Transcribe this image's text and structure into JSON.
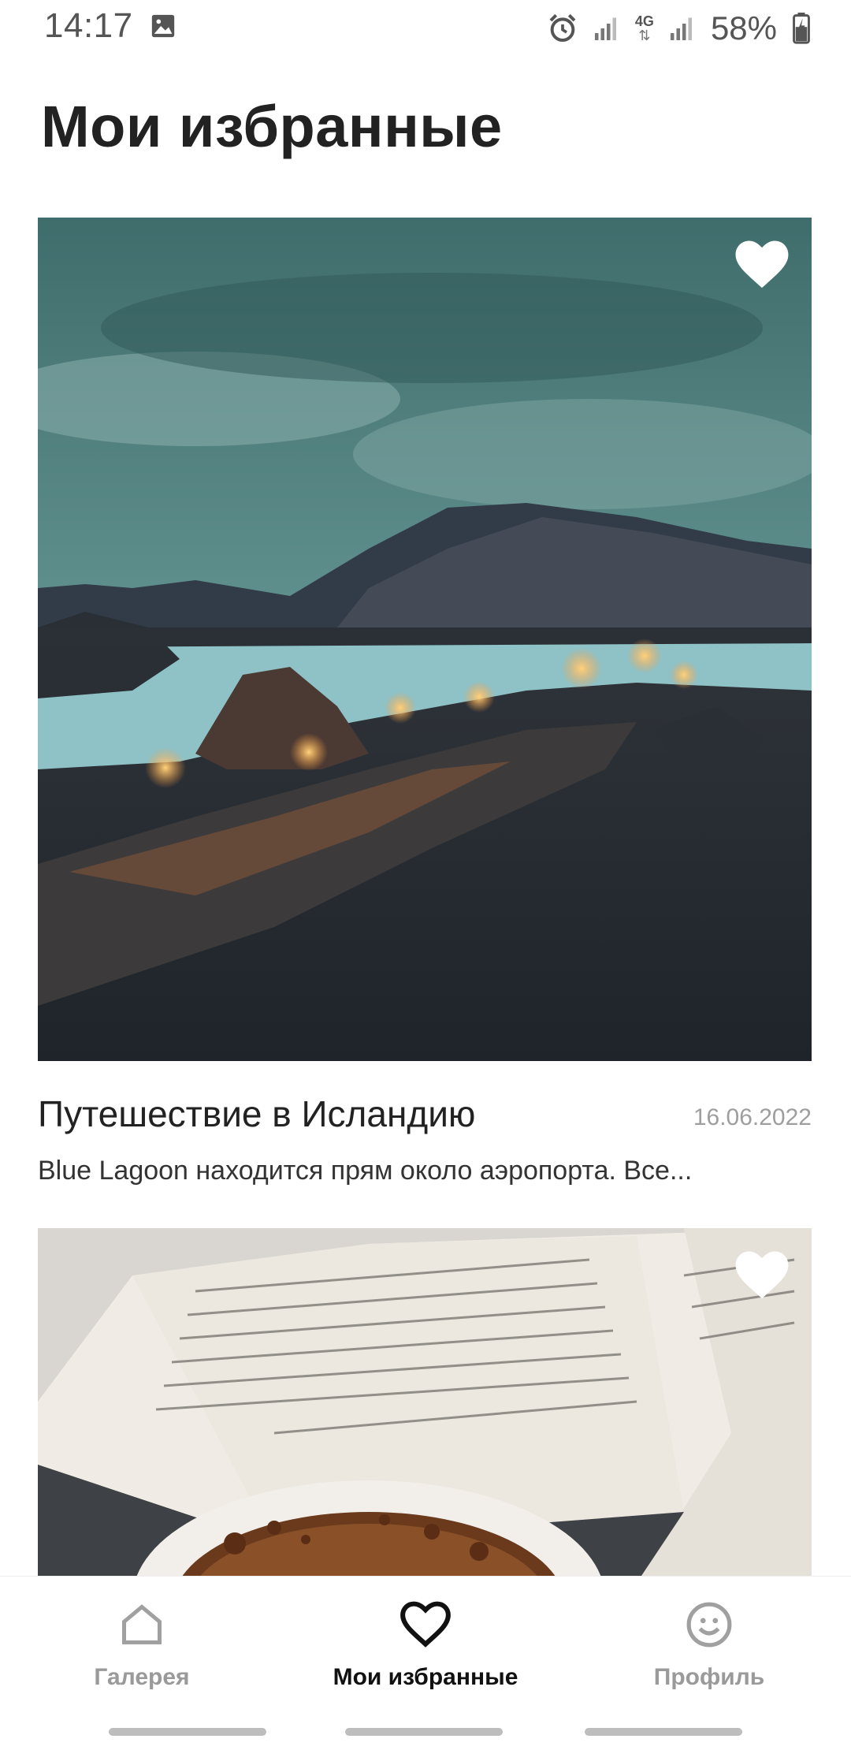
{
  "status_bar": {
    "time": "14:17",
    "battery": "58%",
    "network": "4G",
    "icons": [
      "image-icon",
      "alarm-icon",
      "signal-icon",
      "network-4g-icon",
      "signal-icon",
      "battery-icon"
    ]
  },
  "page": {
    "title": "Мои избранные"
  },
  "cards": [
    {
      "title": "Путешествие в Исландию",
      "date": "16.06.2022",
      "description": "Blue Lagoon находится прям около аэропорта. Все...",
      "favorite_icon": "heart-icon"
    },
    {
      "title": "",
      "date": "",
      "description": "",
      "favorite_icon": "heart-icon"
    }
  ],
  "bottom_nav": {
    "items": [
      {
        "label": "Галерея",
        "icon": "home-icon",
        "active": false
      },
      {
        "label": "Мои избранные",
        "icon": "heart-outline-icon",
        "active": true
      },
      {
        "label": "Профиль",
        "icon": "smiley-icon",
        "active": false
      }
    ]
  },
  "colors": {
    "active": "#111111",
    "inactive": "#9a9a9a",
    "date": "#9e9e9e"
  }
}
